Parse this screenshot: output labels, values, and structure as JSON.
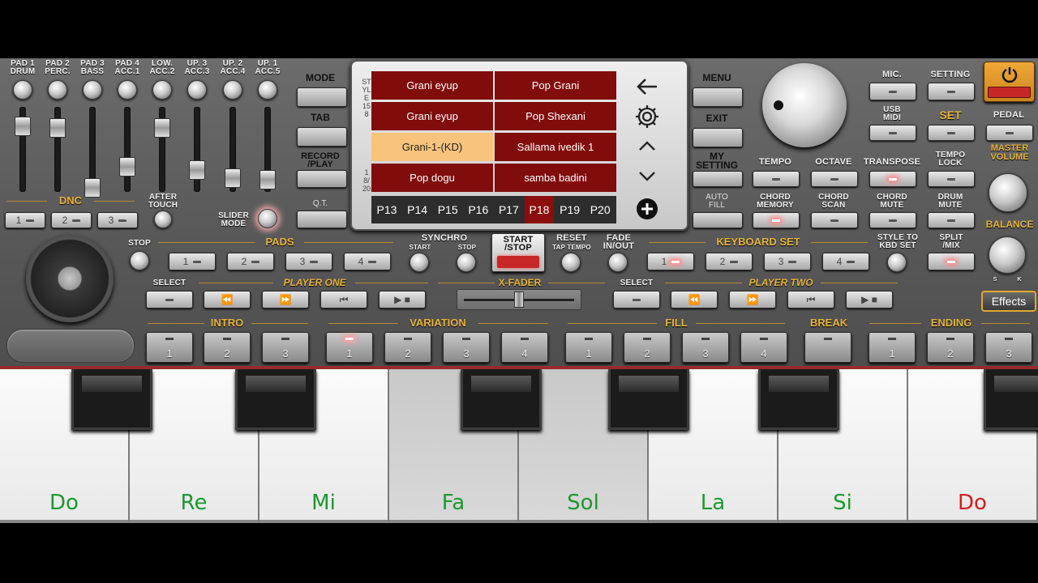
{
  "mixer": {
    "channels": [
      {
        "line1": "PAD 1",
        "line2": "DRUM"
      },
      {
        "line1": "PAD 2",
        "line2": "PERC."
      },
      {
        "line1": "PAD 3",
        "line2": "BASS"
      },
      {
        "line1": "PAD 4",
        "line2": "ACC.1"
      },
      {
        "line1": "LOW.",
        "line2": "ACC.2"
      },
      {
        "line1": "UP. 3",
        "line2": "ACC.3"
      },
      {
        "line1": "UP. 2",
        "line2": "ACC.4"
      },
      {
        "line1": "UP. 1",
        "line2": "ACC.5"
      }
    ],
    "dnc_label": "DNC",
    "dnc_buttons": [
      "1",
      "2",
      "3"
    ],
    "after_touch": [
      "AFTER",
      "TOUCH"
    ],
    "slider_mode": [
      "SLIDER",
      "MODE"
    ]
  },
  "left_side": {
    "mode": "MODE",
    "tab": "TAB",
    "record_play": [
      "RECORD",
      "/PLAY"
    ],
    "qt": "Q.T."
  },
  "screen": {
    "vertical_label": "STYLE 158",
    "vertical_label2": "18/20",
    "styles": [
      {
        "label": "Grani eyup",
        "selected": false
      },
      {
        "label": "Pop Grani",
        "selected": false
      },
      {
        "label": "Grani eyup",
        "selected": false
      },
      {
        "label": "Pop Shexani",
        "selected": false
      },
      {
        "label": "Grani-1-(KD)",
        "selected": true
      },
      {
        "label": "Sallama ivedik 1",
        "selected": false
      },
      {
        "label": "Pop dogu",
        "selected": false
      },
      {
        "label": "samba badini",
        "selected": false
      }
    ],
    "pages": [
      "P13",
      "P14",
      "P15",
      "P16",
      "P17",
      "P18",
      "P19",
      "P20"
    ],
    "active_page": "P18",
    "icons": [
      "back-arrow-icon",
      "gear-icon",
      "chevron-up-icon",
      "chevron-down-icon",
      "plus-circle-icon"
    ]
  },
  "right_side": {
    "menu": "MENU",
    "exit": "EXIT",
    "my_setting": [
      "MY",
      "SETTING"
    ],
    "auto_fill": [
      "AUTO",
      "FILL"
    ]
  },
  "top_right": {
    "mic": "MIC.",
    "setting": "SETTING",
    "usb_midi": [
      "USB",
      "MIDI"
    ],
    "set": "SET",
    "pedal": "PEDAL",
    "tempo": "TEMPO",
    "octave": "OCTAVE",
    "transpose": "TRANSPOSE",
    "tempo_lock": [
      "TEMPO",
      "LOCK"
    ],
    "master_volume": [
      "MASTER",
      "VOLUME"
    ],
    "chord_memory": [
      "CHORD",
      "MEMORY"
    ],
    "chord_scan": [
      "CHORD",
      "SCAN"
    ],
    "chord_mute": [
      "CHORD",
      "MUTE"
    ],
    "drum_mute": [
      "DRUM",
      "MUTE"
    ],
    "balance": "BALANCE",
    "balance_ends": [
      "S",
      "K"
    ]
  },
  "pads_row": {
    "stop": "STOP",
    "pads": "PADS",
    "pad_buttons": [
      "1",
      "2",
      "3",
      "4"
    ],
    "synchro": "SYNCHRO",
    "synchro_start": "START",
    "synchro_stop": "STOP",
    "start_stop": [
      "START",
      "/STOP"
    ],
    "reset": "RESET",
    "tap_tempo": "TAP TEMPO",
    "fade": [
      "FADE",
      "IN/OUT"
    ],
    "keyboard_set": "KEYBOARD SET",
    "kbd_buttons": [
      "1",
      "2",
      "3",
      "4"
    ],
    "style_to_kbd": [
      "STYLE TO",
      "KBD SET"
    ],
    "split_mix": [
      "SPLIT",
      "/MIX"
    ],
    "effects": "Effects"
  },
  "players": {
    "select1": "SELECT",
    "player_one": "PLAYER ONE",
    "x_fader": "X-FADER",
    "x_fader_position": 0.5,
    "select2": "SELECT",
    "player_two": "PLAYER TWO"
  },
  "arranger": {
    "intro": {
      "label": "INTRO",
      "buttons": [
        "1",
        "2",
        "3"
      ]
    },
    "variation": {
      "label": "VARIATION",
      "buttons": [
        "1",
        "2",
        "3",
        "4"
      ]
    },
    "fill": {
      "label": "FILL",
      "buttons": [
        "1",
        "2",
        "3",
        "4"
      ]
    },
    "break": {
      "label": "BREAK"
    },
    "ending": {
      "label": "ENDING",
      "buttons": [
        "1",
        "2",
        "3"
      ]
    }
  },
  "keyboard": {
    "keys": [
      {
        "name": "Do",
        "color": "#1a9a2e"
      },
      {
        "name": "Re",
        "color": "#1a9a2e"
      },
      {
        "name": "Mi",
        "color": "#1a9a2e"
      },
      {
        "name": "Fa",
        "color": "#1a9a2e"
      },
      {
        "name": "Sol",
        "color": "#1a9a2e"
      },
      {
        "name": "La",
        "color": "#1a9a2e"
      },
      {
        "name": "Si",
        "color": "#1a9a2e"
      },
      {
        "name": "Do",
        "color": "#d42020"
      }
    ]
  },
  "colors": {
    "accent_gold": "#e7b43c",
    "style_cell": "#800c0c",
    "style_selected": "#f8c37d",
    "active_led": "#ff8a8a"
  }
}
